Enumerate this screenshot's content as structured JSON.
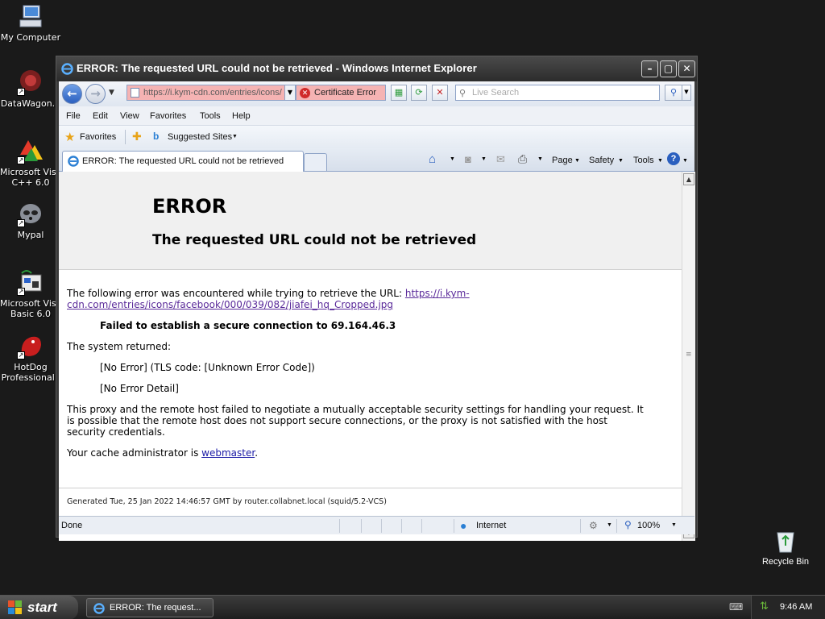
{
  "desktop": {
    "icons": [
      {
        "label": "My Computer"
      },
      {
        "label": "DataWagon..."
      },
      {
        "label": "Microsoft Visu",
        "label2": "C++ 6.0"
      },
      {
        "label": "Mypal"
      },
      {
        "label": "Microsoft Visu",
        "label2": "Basic 6.0"
      },
      {
        "label": "HotDog",
        "label2": "Professional '"
      }
    ],
    "recycle_bin": "Recycle Bin"
  },
  "window": {
    "title": "ERROR: The requested URL could not be retrieved - Windows Internet Explorer",
    "url": "https://i.kym-cdn.com/entries/icons/",
    "certificate_error": "Certificate Error",
    "search_placeholder": "Live Search",
    "menu": [
      "File",
      "Edit",
      "View",
      "Favorites",
      "Tools",
      "Help"
    ],
    "favorites_label": "Favorites",
    "suggested_sites": "Suggested Sites",
    "tab_title": "ERROR: The requested URL could not be retrieved",
    "commands": {
      "page": "Page",
      "safety": "Safety",
      "tools": "Tools"
    }
  },
  "page": {
    "heading": "ERROR",
    "subheading": "The requested URL could not be retrieved",
    "intro": "The following error was encountered while trying to retrieve the URL: ",
    "link_line1": "https://i.kym-",
    "link_line2": "cdn.com/entries/icons/facebook/000/039/082/jiafei_hq_Cropped.jpg",
    "failure": "Failed to establish a secure connection to 69.164.46.3",
    "system_returned": "The system returned:",
    "no_error": "[No Error] (TLS code: [Unknown Error Code])",
    "no_detail": "[No Error Detail]",
    "explanation_1": "This proxy and the remote host failed to negotiate a mutually acceptable security settings for handling your request. It",
    "explanation_2": "is possible that the remote host does not support secure connections, or the proxy is not satisfied with the host",
    "explanation_3": "security credentials.",
    "cache_admin": "Your cache administrator is ",
    "webmaster": "webmaster",
    "period": ".",
    "generated": "Generated Tue, 25 Jan 2022 14:46:57 GMT by router.collabnet.local (squid/5.2-VCS)"
  },
  "status": {
    "left": "Done",
    "zone": "Internet",
    "zoom": "100%"
  },
  "taskbar": {
    "start": "start",
    "task": "ERROR: The request...",
    "clock": "9:46 AM"
  }
}
